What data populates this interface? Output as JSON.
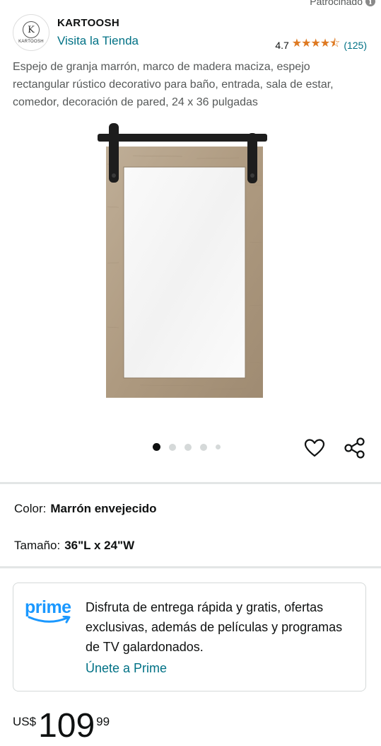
{
  "sponsored": {
    "label": "Patrocinado",
    "info_icon": "i"
  },
  "brand": {
    "logo_letter": "K",
    "logo_text": "KARTOOSH",
    "name": "KARTOOSH",
    "visit_store": "Visita la Tienda"
  },
  "rating": {
    "value": "4.7",
    "stars": "★★★★⯪",
    "count": "(125)",
    "star_color": "#de7921"
  },
  "product": {
    "title": "Espejo de granja marrón, marco de madera maciza, espejo rectangular rústico decorativo para baño, entrada, sala de estar, comedor, decoración de pared, 24 x 36 pulgadas"
  },
  "gallery": {
    "image_count": 5,
    "active_index": 0
  },
  "actions": {
    "wishlist_icon": "heart-icon",
    "share_icon": "share-icon"
  },
  "variations": {
    "color": {
      "label": "Color:",
      "value": "Marrón envejecido"
    },
    "size": {
      "label": "Tamaño:",
      "value": "36\"L x 24\"W"
    }
  },
  "prime": {
    "logo": "prime",
    "text": "Disfruta de entrega rápida y gratis, ofertas exclusivas, además de películas y programas de TV galardonados.",
    "link": "Únete a Prime",
    "brand_color": "#1a98ff"
  },
  "price": {
    "currency": "US$",
    "whole": "109",
    "fraction": "99"
  },
  "colors": {
    "link": "#007185",
    "text": "#0f1111",
    "muted": "#565959"
  }
}
